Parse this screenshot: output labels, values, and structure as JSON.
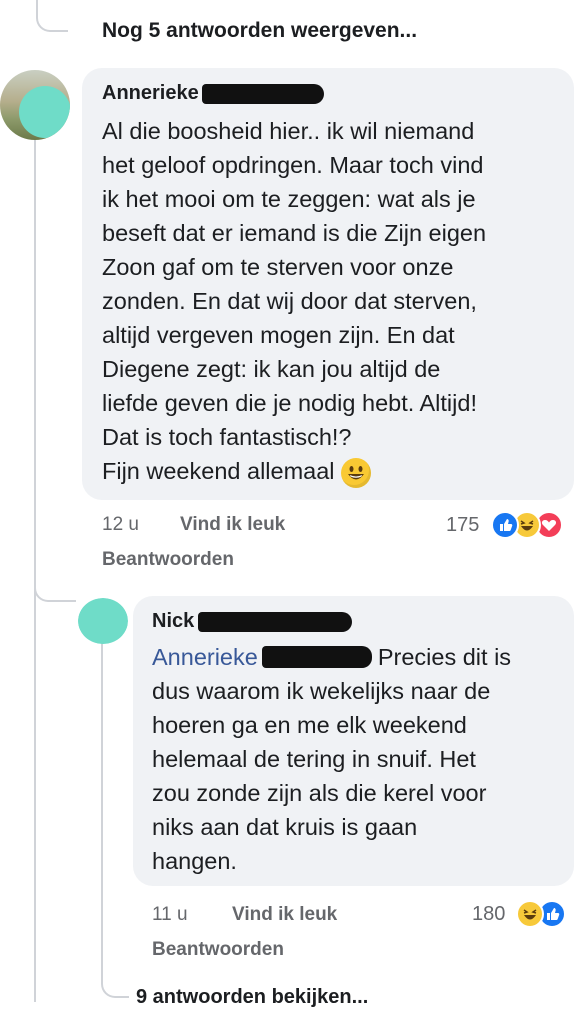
{
  "top_link": {
    "label": "Nog 5 antwoorden weergeven..."
  },
  "comment1": {
    "author": "Annerieke",
    "lines": [
      "Al die boosheid hier.. ik wil niemand",
      "het geloof opdringen. Maar toch vind",
      "ik het mooi om te zeggen: wat als je",
      "beseft dat er iemand is die Zijn eigen",
      "Zoon gaf om te sterven voor onze",
      "zonden. En dat wij door dat sterven,",
      "altijd vergeven mogen zijn. En dat",
      "Diegene zegt: ik kan jou altijd de",
      "liefde geven die je nodig hebt. Altijd!",
      "Dat is toch fantastisch!?",
      "Fijn weekend allemaal"
    ],
    "time": "12 u",
    "like": "Vind ik leuk",
    "reply": "Beantwoorden",
    "reaction_count": "175",
    "reactions": [
      "like-icon",
      "haha-icon",
      "love-icon"
    ]
  },
  "comment2": {
    "author": "Nick",
    "mention": "Annerieke",
    "first_line_rest": "Precies dit is",
    "lines": [
      "dus waarom ik wekelijks naar de",
      "hoeren ga en me elk weekend",
      "helemaal de tering in snuif. Het",
      "zou zonde zijn als die kerel voor",
      "niks aan dat kruis is gaan",
      "hangen."
    ],
    "time": "11 u",
    "like": "Vind ik leuk",
    "reply": "Beantwoorden",
    "reaction_count": "180",
    "reactions": [
      "haha-icon",
      "like-icon"
    ]
  },
  "bottom_link": {
    "label": "9 antwoorden bekijken..."
  },
  "colors": {
    "bubble": "#f0f2f5",
    "meta": "#65676b",
    "mention": "#385898",
    "like": "#1877f2",
    "love": "#f33e58",
    "haha": "#f7c93a"
  }
}
